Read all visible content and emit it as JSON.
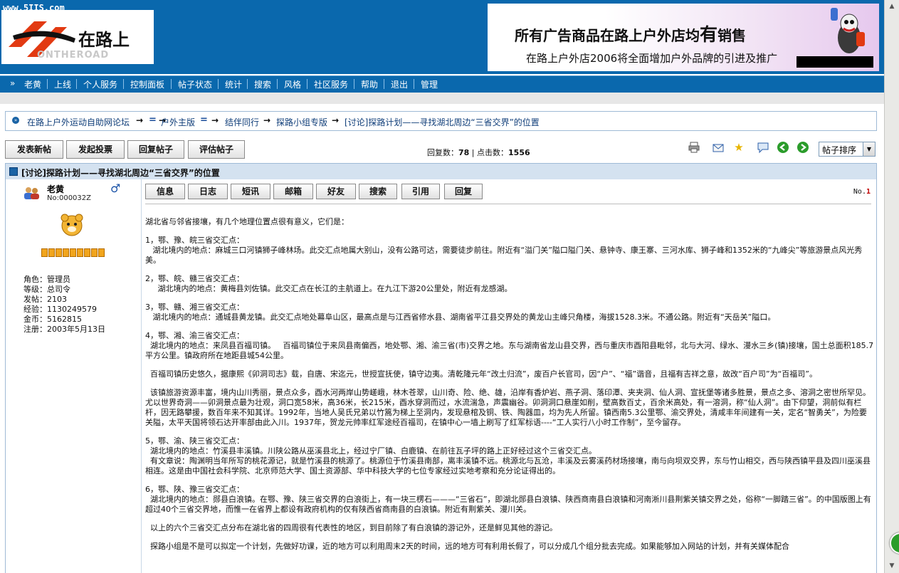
{
  "header": {
    "site_url": "www.5IIS.com",
    "logo_text": "在路上",
    "logo_sub": "ONTHEROAD",
    "banner_line1_a": "所有广告商品在路上户外店均",
    "banner_line1_b": "有",
    "banner_line1_c": "销售",
    "banner_line2": "在路上户外店2006将全面增加户外品牌的引进及推广"
  },
  "nav": {
    "lead": "»",
    "items": [
      "老黄",
      "上线",
      "个人服务",
      "控制面板",
      "帖子状态",
      "统计",
      "搜索",
      "风格",
      "社区服务",
      "帮助",
      "退出",
      "管理"
    ]
  },
  "breadcrumb": {
    "items": [
      "在路上户外运动自助网论坛",
      "户外主版",
      "结伴同行",
      "探路小组专版",
      "[讨论]探路计划——寻找湖北周边“三省交界”的位置"
    ],
    "arrow": "→",
    "eq": "="
  },
  "actions": {
    "buttons": [
      "发表新帖",
      "发起投票",
      "回复帖子",
      "评估帖子"
    ],
    "reply_label": "回复数：",
    "reply_count": "78",
    "click_label": " | 点击数：",
    "click_count": "1556",
    "sort_label": "帖子排序"
  },
  "thread": {
    "title": "[讨论]探路计划——寻找湖北周边“三省交界”的位置"
  },
  "user": {
    "name": "老黄",
    "no": "No:000032Z",
    "gender_symbol": "♂",
    "info": [
      "角色：管理员",
      "等级：总司令",
      "发帖：2103",
      "经验：1130249579",
      "金币：5162815",
      "注册：2003年5月13日"
    ]
  },
  "post": {
    "buttons": [
      "信息",
      "日志",
      "短讯",
      "邮箱",
      "好友",
      "搜索",
      "引用",
      "回复"
    ],
    "floor_label": "No.",
    "floor_num": "1",
    "paragraphs": [
      "湖北省与邻省接壤，有几个地理位置点很有意义，它们是：",
      "1，鄂、豫、皖三省交汇点：\n   湖北境内的地点：麻城三口河镇狮子峰林场。此交汇点地属大别山，没有公路可达，需要徒步前往。附近有“溢门关”隘口隘门关、悬钟寺、康王寨、三河水库、狮子峰和1352米的“九峰尖”等旅游景点风光秀美。",
      "2，鄂、皖、赣三省交汇点：\n     湖北境内的地点：黄梅县刘佐镇。此交汇点在长江的主航道上。在九江下游20公里处，附近有龙感湖。",
      "3，鄂、赣、湘三省交汇点：\n   湖北境内的地点：通城县黄龙镇。此交汇点地处幕阜山区，最高点是与江西省修水县、湖南省平江县交界处的黄龙山主峰只角楼，海拔1528.3米。不通公路。附近有“天岳关”隘口。",
      "4，鄂、湘、渝三省交汇点：\n  湖北境内的地点：来凤县百福司镇。   百福司镇位于来凤县南偏西，地处鄂、湘、渝三省(市)交界之地。东与湖南省龙山县交界，西与重庆市酉阳县毗邻，北与大河、绿水、漫水三乡(镇)接壤，国土总面积185.7平方公里。镇政府所在地距县城54公里。",
      "  百福司镇历史悠久，据康熙《卯洞司志》载，自唐、宋迄元，世授宣抚使，镇守边夷。清乾隆元年“改土归流”，废百户长官司，因“户”、“福”谐音，且福有吉祥之意，故改“百户司”为“百福司”。",
      "  该镇旅游资源丰富，境内山川秀丽，景点众多，酉水河两岸山势嵯峨，林木苍翠，山川奇、险、绝、雄，沿岸有香炉岩、燕子洞、落印潭、夹夹洞、仙人洞、宣抚堡等诸多胜景，景点之多、溶洞之密世所罕见。尤以世界奇洞——卯洞景点最为壮观，洞口宽58米，高36米，长215米，酉水穿洞而过，水流湍急，声震幽谷。卯洞洞口悬崖如削，壁高数百丈，百余米高处，有一溶洞，称“仙人洞”。由下仰望，洞前似有栏杆，因无路攀援，数百年来不知其详。1992年，当地人吴氏兄弟以竹篙为梯上至洞内，发现悬棺及铜、铁、陶器皿，均为先人所留。镇西南5.3公里鄂、渝交界处，清咸丰年间建有一关，定名“智勇关”，为险要关隘，太平天国将领石达开率部由此入川。1937年，贺龙元帅率红军途经百福司，在镇中心一墙上刷写了红军标语----“工人实行八小时工作制”，至今留存。",
      "5，鄂、渝、陕三省交汇点：\n  湖北境内的地点：竹溪县丰溪镇。川陕公路从巫溪县北上，经过宁厂镇、白鹿镇、在前往瓦子坪的路上正好经过这个三省交汇点。\n  有文章说：陶渊明当年所写的桃花源记，就是竹溪县的桃源了。桃源位于竹溪县南部，离丰溪镇不远。桃源北与瓦沧，丰溪及云雾溪药材场接壤，南与向坝双交界，东与竹山相交，西与陕西镇平县及四川巫溪县相连。这是由中国社会科学院、北京师范大学、国土资源部、华中科技大学的七位专家经过实地考察和充分论证得出的。",
      "6，鄂、陕、豫三省交汇点：\n  湖北境内的地点：郧县白浪镇。在鄂、豫、陕三省交界的白浪街上，有一块三楞石———“三省石”，即湖北郧县白浪镇、陕西商南县白浪镇和河南淅川县荆紫关镇交界之处，俗称“一脚踏三省”。的中国版图上有超过40个三省交界地，而惟一在省界上都设有政府机构的仅有陕西省商南县的白浪镇。附近有荆紫关、漫川关。",
      "  以上的六个三省交汇点分布在湖北省的四周很有代表性的地区，到目前除了有白浪镇的游记外，还是鲜见其他的游记。",
      "  探路小组是不是可以拟定一个计划，先做好功课，近的地方可以利用周末2天的时间，远的地方可有利用长假了，可以分成几个组分批去完成。如果能够加入网站的计划，并有关媒体配合"
    ]
  },
  "colors": {
    "header_blue": "#0a68ad",
    "link_blue": "#113f7a",
    "title_bar": "#d4e2f0",
    "floor_red": "#c00000"
  }
}
